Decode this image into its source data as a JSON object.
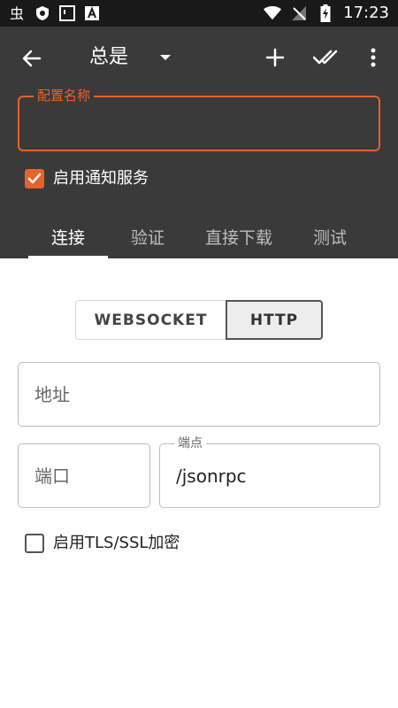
{
  "status_bar": {
    "time": "17:23",
    "icons": [
      "app-badge-icon",
      "shield-icon",
      "square-icon",
      "font-icon",
      "wifi-icon",
      "no-signal-icon",
      "battery-charging-icon"
    ]
  },
  "toolbar": {
    "title": "总是",
    "icons": {
      "back": "arrow-left-icon",
      "dropdown": "caret-down-icon",
      "add": "plus-icon",
      "done": "double-check-icon",
      "more": "more-vertical-icon"
    }
  },
  "profile": {
    "name_label": "配置名称",
    "name_value": "",
    "notification_label": "启用通知服务",
    "notification_checked": true
  },
  "tabs": [
    {
      "label": "连接",
      "active": true
    },
    {
      "label": "验证",
      "active": false
    },
    {
      "label": "直接下载",
      "active": false
    },
    {
      "label": "测试",
      "active": false
    }
  ],
  "connection": {
    "mode_options": [
      "WEBSOCKET",
      "HTTP"
    ],
    "selected_mode": "HTTP",
    "address_placeholder": "地址",
    "address_value": "",
    "port_placeholder": "端口",
    "port_value": "",
    "path_label": "端点",
    "path_value": "/jsonrpc",
    "tls_label": "启用TLS/SSL加密",
    "tls_checked": false
  },
  "colors": {
    "accent": "#e9622b",
    "header_bg": "#3a3a3a",
    "status_bar_bg": "#191919"
  }
}
